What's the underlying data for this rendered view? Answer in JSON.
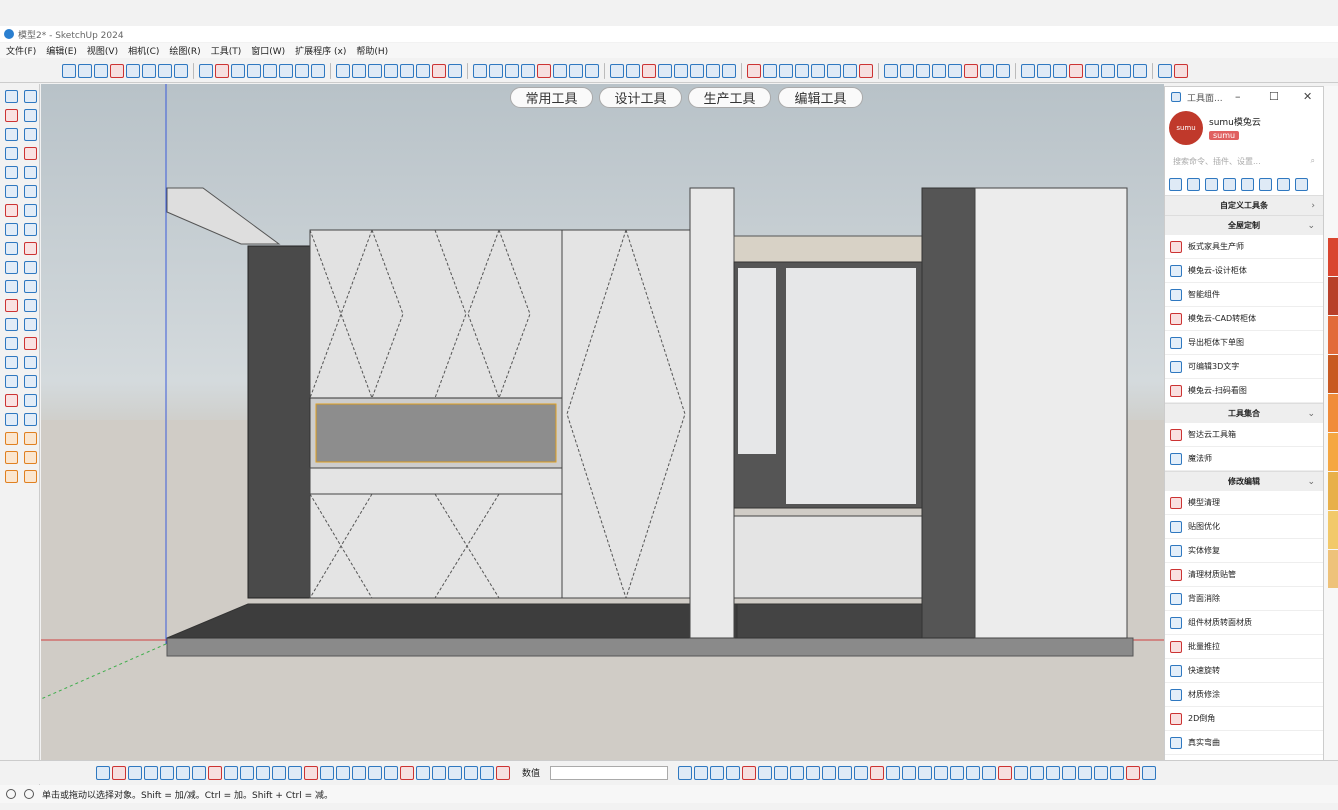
{
  "window": {
    "title": "模型2* - SketchUp 2024"
  },
  "menu": [
    "文件(F)",
    "编辑(E)",
    "视图(V)",
    "相机(C)",
    "绘图(R)",
    "工具(T)",
    "窗口(W)",
    "扩展程序 (x)",
    "帮助(H)"
  ],
  "tabs": [
    "常用工具",
    "设计工具",
    "生产工具",
    "编辑工具"
  ],
  "panel": {
    "title": "工具面...",
    "brand_name": "sumu模兔云",
    "brand_badge": "sumu",
    "search_placeholder": "搜索命令、插件、设置...",
    "sections": [
      {
        "title": "自定义工具条",
        "arrow": "›",
        "items": []
      },
      {
        "title": "全屋定制",
        "arrow": "⌄",
        "items": [
          "板式家具生产师",
          "模兔云-设计柜体",
          "智能组件",
          "模兔云-CAD转柜体",
          "导出柜体下单图",
          "可编辑3D文字",
          "模兔云-扫码看图"
        ]
      },
      {
        "title": "工具集合",
        "arrow": "⌄",
        "items": [
          "智达云工具箱",
          "魔法师"
        ]
      },
      {
        "title": "修改编辑",
        "arrow": "⌄",
        "items": [
          "模型清理",
          "贴图优化",
          "实体修复",
          "清理材质贴管",
          "背面消除",
          "组件材质转面材质",
          "批量推拉",
          "快速旋转",
          "材质修涂",
          "2D倒角",
          "真实弯曲"
        ]
      }
    ],
    "colors": {
      "accent": "#c0392b",
      "brand_badge": "#e06060"
    }
  },
  "statusbar": {
    "hint": "单击或拖动以选择对象。Shift = 加/减。Ctrl = 加。Shift + Ctrl = 减。",
    "measure_label": "数值",
    "measure_value": ""
  },
  "swatches": [
    "#d9452f",
    "#b8402a",
    "#e26b3a",
    "#c85a22",
    "#f08c3a",
    "#f5a742",
    "#e8b04a",
    "#f2c96a",
    "#eec27a"
  ]
}
